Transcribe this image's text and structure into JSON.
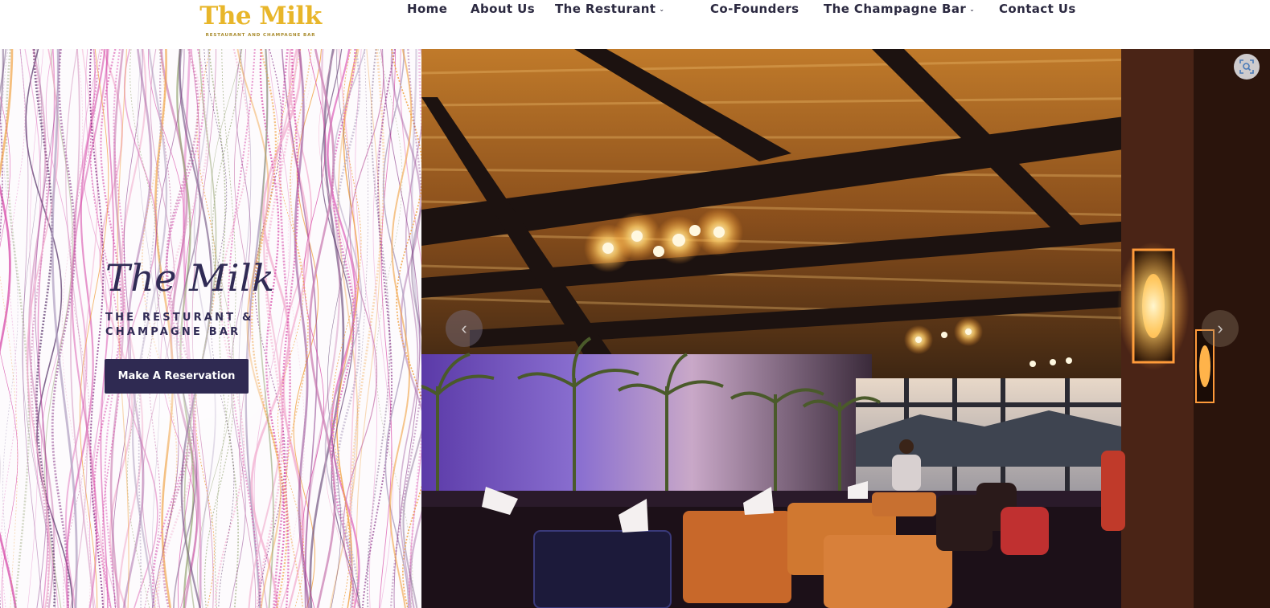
{
  "brand": {
    "name": "The Milk",
    "tagline": "RESTAURANT AND CHAMPAGNE BAR"
  },
  "nav": {
    "items": [
      {
        "label": "Home"
      },
      {
        "label": "About Us"
      },
      {
        "label": "The Resturant",
        "has_dropdown": true
      },
      {
        "label": "Co-Founders"
      },
      {
        "label": "The Champagne Bar",
        "has_dropdown": true
      },
      {
        "label": "Contact Us"
      }
    ],
    "dropdown_glyph": "⌄"
  },
  "hero": {
    "title": "The Milk",
    "subtitle": "THE RESTURANT & CHAMPAGNE BAR",
    "cta_label": "Make A Reservation",
    "carousel": {
      "prev_glyph": "‹",
      "next_glyph": "›"
    }
  },
  "colors": {
    "brand_gold": "#e8b62a",
    "navy": "#2f2a52",
    "nav_text": "#2b2940"
  },
  "icons": [
    "chevron-down-icon",
    "chevron-left-icon",
    "chevron-right-icon",
    "zoom-scan-icon"
  ]
}
